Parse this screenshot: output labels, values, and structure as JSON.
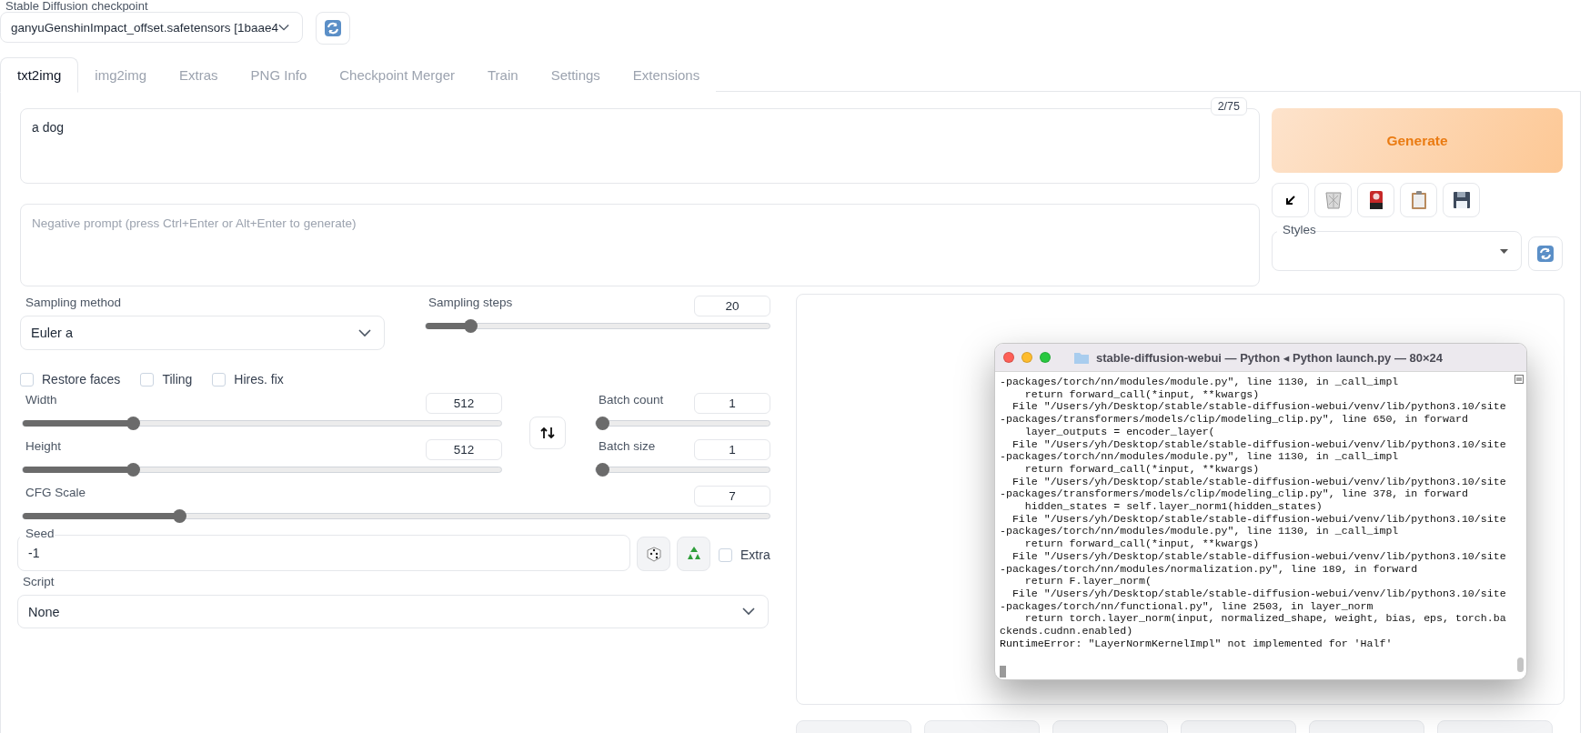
{
  "checkpoint": {
    "label": "Stable Diffusion checkpoint",
    "value": "ganyuGenshinImpact_offset.safetensors [1baae4"
  },
  "tabs": [
    {
      "label": "txt2img",
      "selected": true
    },
    {
      "label": "img2img",
      "selected": false
    },
    {
      "label": "Extras",
      "selected": false
    },
    {
      "label": "PNG Info",
      "selected": false
    },
    {
      "label": "Checkpoint Merger",
      "selected": false
    },
    {
      "label": "Train",
      "selected": false
    },
    {
      "label": "Settings",
      "selected": false
    },
    {
      "label": "Extensions",
      "selected": false
    }
  ],
  "prompt": {
    "value": "a dog",
    "token_count": "2/75"
  },
  "negative_prompt": {
    "placeholder": "Negative prompt (press Ctrl+Enter or Alt+Enter to generate)"
  },
  "generate_button": "Generate",
  "styles": {
    "label": "Styles"
  },
  "sampling_method": {
    "label": "Sampling method",
    "value": "Euler a"
  },
  "sampling_steps": {
    "label": "Sampling steps",
    "value": "20",
    "level": 0.13
  },
  "checkboxes": [
    {
      "label": "Restore faces",
      "checked": false
    },
    {
      "label": "Tiling",
      "checked": false
    },
    {
      "label": "Hires. fix",
      "checked": false
    }
  ],
  "width": {
    "label": "Width",
    "value": "512",
    "level": 0.23
  },
  "height": {
    "label": "Height",
    "value": "512",
    "level": 0.23
  },
  "batch_count": {
    "label": "Batch count",
    "value": "1",
    "level": 0
  },
  "batch_size": {
    "label": "Batch size",
    "value": "1",
    "level": 0
  },
  "cfg_scale": {
    "label": "CFG Scale",
    "value": "7",
    "level": 0.21
  },
  "seed": {
    "label": "Seed",
    "value": "-1"
  },
  "extra": {
    "label": "Extra",
    "checked": false
  },
  "script": {
    "label": "Script",
    "value": "None"
  },
  "terminal": {
    "title": "stable-diffusion-webui — Python ◂ Python launch.py — 80×24",
    "lines": [
      "-packages/torch/nn/modules/module.py\", line 1130, in _call_impl",
      "    return forward_call(*input, **kwargs)",
      "  File \"/Users/yh/Desktop/stable/stable-diffusion-webui/venv/lib/python3.10/site",
      "-packages/transformers/models/clip/modeling_clip.py\", line 650, in forward",
      "    layer_outputs = encoder_layer(",
      "  File \"/Users/yh/Desktop/stable/stable-diffusion-webui/venv/lib/python3.10/site",
      "-packages/torch/nn/modules/module.py\", line 1130, in _call_impl",
      "    return forward_call(*input, **kwargs)",
      "  File \"/Users/yh/Desktop/stable/stable-diffusion-webui/venv/lib/python3.10/site",
      "-packages/transformers/models/clip/modeling_clip.py\", line 378, in forward",
      "    hidden_states = self.layer_norm1(hidden_states)",
      "  File \"/Users/yh/Desktop/stable/stable-diffusion-webui/venv/lib/python3.10/site",
      "-packages/torch/nn/modules/module.py\", line 1130, in _call_impl",
      "    return forward_call(*input, **kwargs)",
      "  File \"/Users/yh/Desktop/stable/stable-diffusion-webui/venv/lib/python3.10/site",
      "-packages/torch/nn/modules/normalization.py\", line 189, in forward",
      "    return F.layer_norm(",
      "  File \"/Users/yh/Desktop/stable/stable-diffusion-webui/venv/lib/python3.10/site",
      "-packages/torch/nn/functional.py\", line 2503, in layer_norm",
      "    return torch.layer_norm(input, normalized_shape, weight, bias, eps, torch.ba",
      "ckends.cudnn.enabled)",
      "RuntimeError: \"LayerNormKernelImpl\" not implemented for 'Half'"
    ]
  }
}
